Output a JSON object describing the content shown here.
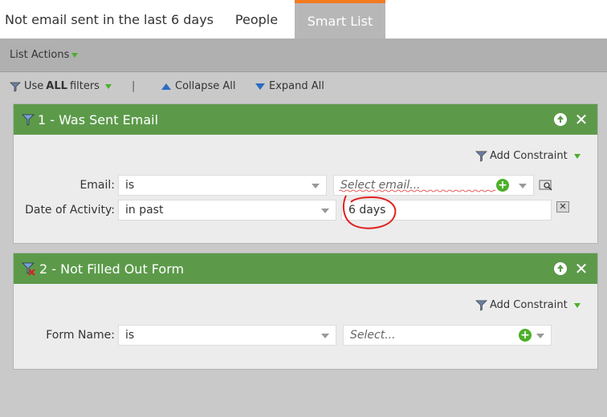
{
  "tabs": [
    {
      "label": "Not email sent in the last 6 days"
    },
    {
      "label": "People"
    },
    {
      "label": "Smart List"
    }
  ],
  "list_actions": {
    "label": "List Actions"
  },
  "toolbar": {
    "use_prefix": "Use",
    "use_bold": "ALL",
    "use_suffix": "filters",
    "separator": "|",
    "collapse": "Collapse All",
    "expand": "Expand All"
  },
  "filters": [
    {
      "title": "1 - Was Sent Email",
      "add_constraint": "Add Constraint",
      "rows": [
        {
          "label": "Email:",
          "operator": "is",
          "value": "",
          "placeholder": "Select email..."
        },
        {
          "label": "Date of Activity:",
          "operator": "in past",
          "value": "6 days"
        }
      ]
    },
    {
      "title": "2 - Not Filled Out Form",
      "add_constraint": "Add Constraint",
      "rows": [
        {
          "label": "Form Name:",
          "operator": "is",
          "value": "",
          "placeholder": "Select..."
        }
      ]
    }
  ],
  "colors": {
    "panel_header": "#5c9a4a",
    "active_tab_accent": "#f37b20",
    "annotation_circle": "#e0201e"
  }
}
